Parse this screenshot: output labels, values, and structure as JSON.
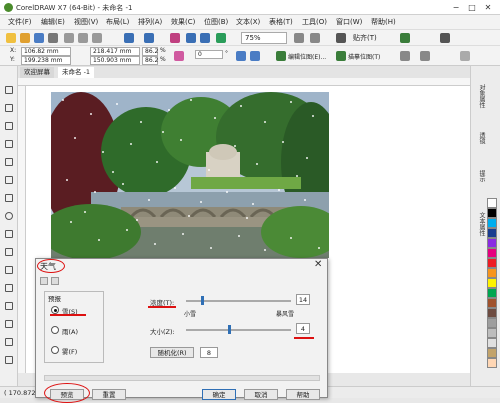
{
  "window": {
    "title": "CorelDRAW X7 (64-Bit) - 未命名 -1",
    "controls": [
      "−",
      "□",
      "✕"
    ]
  },
  "menu": [
    "文件(F)",
    "编辑(E)",
    "视图(V)",
    "布局(L)",
    "排列(A)",
    "效果(C)",
    "位图(B)",
    "文本(X)",
    "表格(T)",
    "工具(O)",
    "窗口(W)",
    "帮助(H)"
  ],
  "toolbar": {
    "zoom": "75%",
    "snap_label": "贴齐(T)"
  },
  "propbar": {
    "x": "106.82 mm",
    "y": "199.238 mm",
    "w": "218.417 mm",
    "h": "150.903 mm",
    "scale_w": "86.2",
    "scale_h": "86.2",
    "scale_unit": "%",
    "angle": "0",
    "angle_unit": "°",
    "edit_bitmap": "编辑位图(E)...",
    "trace_bitmap": "描摹位图(T)"
  },
  "tabs": [
    "欢迎屏幕",
    "未命名 -1"
  ],
  "dockers": [
    "对象属性",
    "透镜",
    "提示",
    "文本属性"
  ],
  "palette_colors": [
    "#ffffff",
    "#000000",
    "#00aeef",
    "#1a3d8f",
    "#8a2be2",
    "#e6007e",
    "#ed1c24",
    "#f7941d",
    "#fff200",
    "#00a651",
    "#a0522d",
    "#6d4c41",
    "#9e9e9e",
    "#bdbdbd",
    "#e0e0e0",
    "#c2a36b",
    "#ffd7b5"
  ],
  "status": {
    "coords": "( 170.872, 2"
  },
  "dialog": {
    "title": "天气",
    "close": "✕",
    "preset_label": "预报",
    "options": [
      "雪(S)",
      "雨(A)",
      "雾(F)"
    ],
    "selected_option": 0,
    "density_label": "浓度(T):",
    "density_value": "14",
    "density_level": 14,
    "density_min_label": "小雪",
    "density_max_label": "暴风雪",
    "size_label": "大小(Z):",
    "size_value": "4",
    "size_level": 4,
    "randomize_label": "随机化(R)",
    "randomize_value": "8",
    "buttons": [
      "预览",
      "重置",
      "确定",
      "取消",
      "帮助"
    ]
  }
}
